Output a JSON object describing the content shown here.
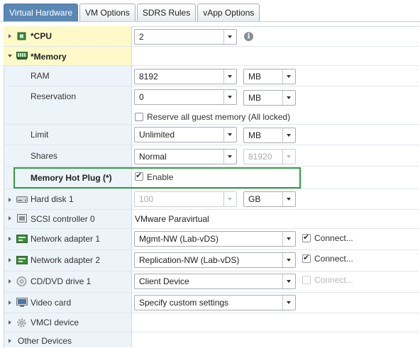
{
  "tabs": [
    "Virtual Hardware",
    "VM Options",
    "SDRS Rules",
    "vApp Options"
  ],
  "rows": {
    "cpu": {
      "label": "*CPU",
      "value": "2"
    },
    "memory": {
      "label": "*Memory"
    },
    "ram": {
      "label": "RAM",
      "value": "8192",
      "unit": "MB"
    },
    "reservation": {
      "label": "Reservation",
      "value": "0",
      "unit": "MB",
      "reserve_all": "Reserve all guest memory (All locked)"
    },
    "limit": {
      "label": "Limit",
      "value": "Unlimited",
      "unit": "MB"
    },
    "shares": {
      "label": "Shares",
      "value": "Normal",
      "amount": "81920"
    },
    "hotplug": {
      "label": "Memory Hot Plug (*)",
      "enable": "Enable"
    },
    "harddisk": {
      "label": "Hard disk 1",
      "value": "100",
      "unit": "GB"
    },
    "scsi": {
      "label": "SCSI controller 0",
      "value": "VMware Paravirtual"
    },
    "net1": {
      "label": "Network adapter 1",
      "value": "Mgmt-NW (Lab-vDS)",
      "connect": "Connect..."
    },
    "net2": {
      "label": "Network adapter 2",
      "value": "Replication-NW (Lab-vDS)",
      "connect": "Connect..."
    },
    "cd": {
      "label": "CD/DVD drive 1",
      "value": "Client Device",
      "connect": "Connect..."
    },
    "video": {
      "label": "Video card",
      "value": "Specify custom settings"
    },
    "vmci": {
      "label": "VMCI device"
    },
    "other": {
      "label": "Other Devices"
    }
  },
  "colors": {
    "accent": "#5a87b4",
    "highlight_box": "#2f9e3f",
    "memory_row": "#fdf9c9"
  }
}
